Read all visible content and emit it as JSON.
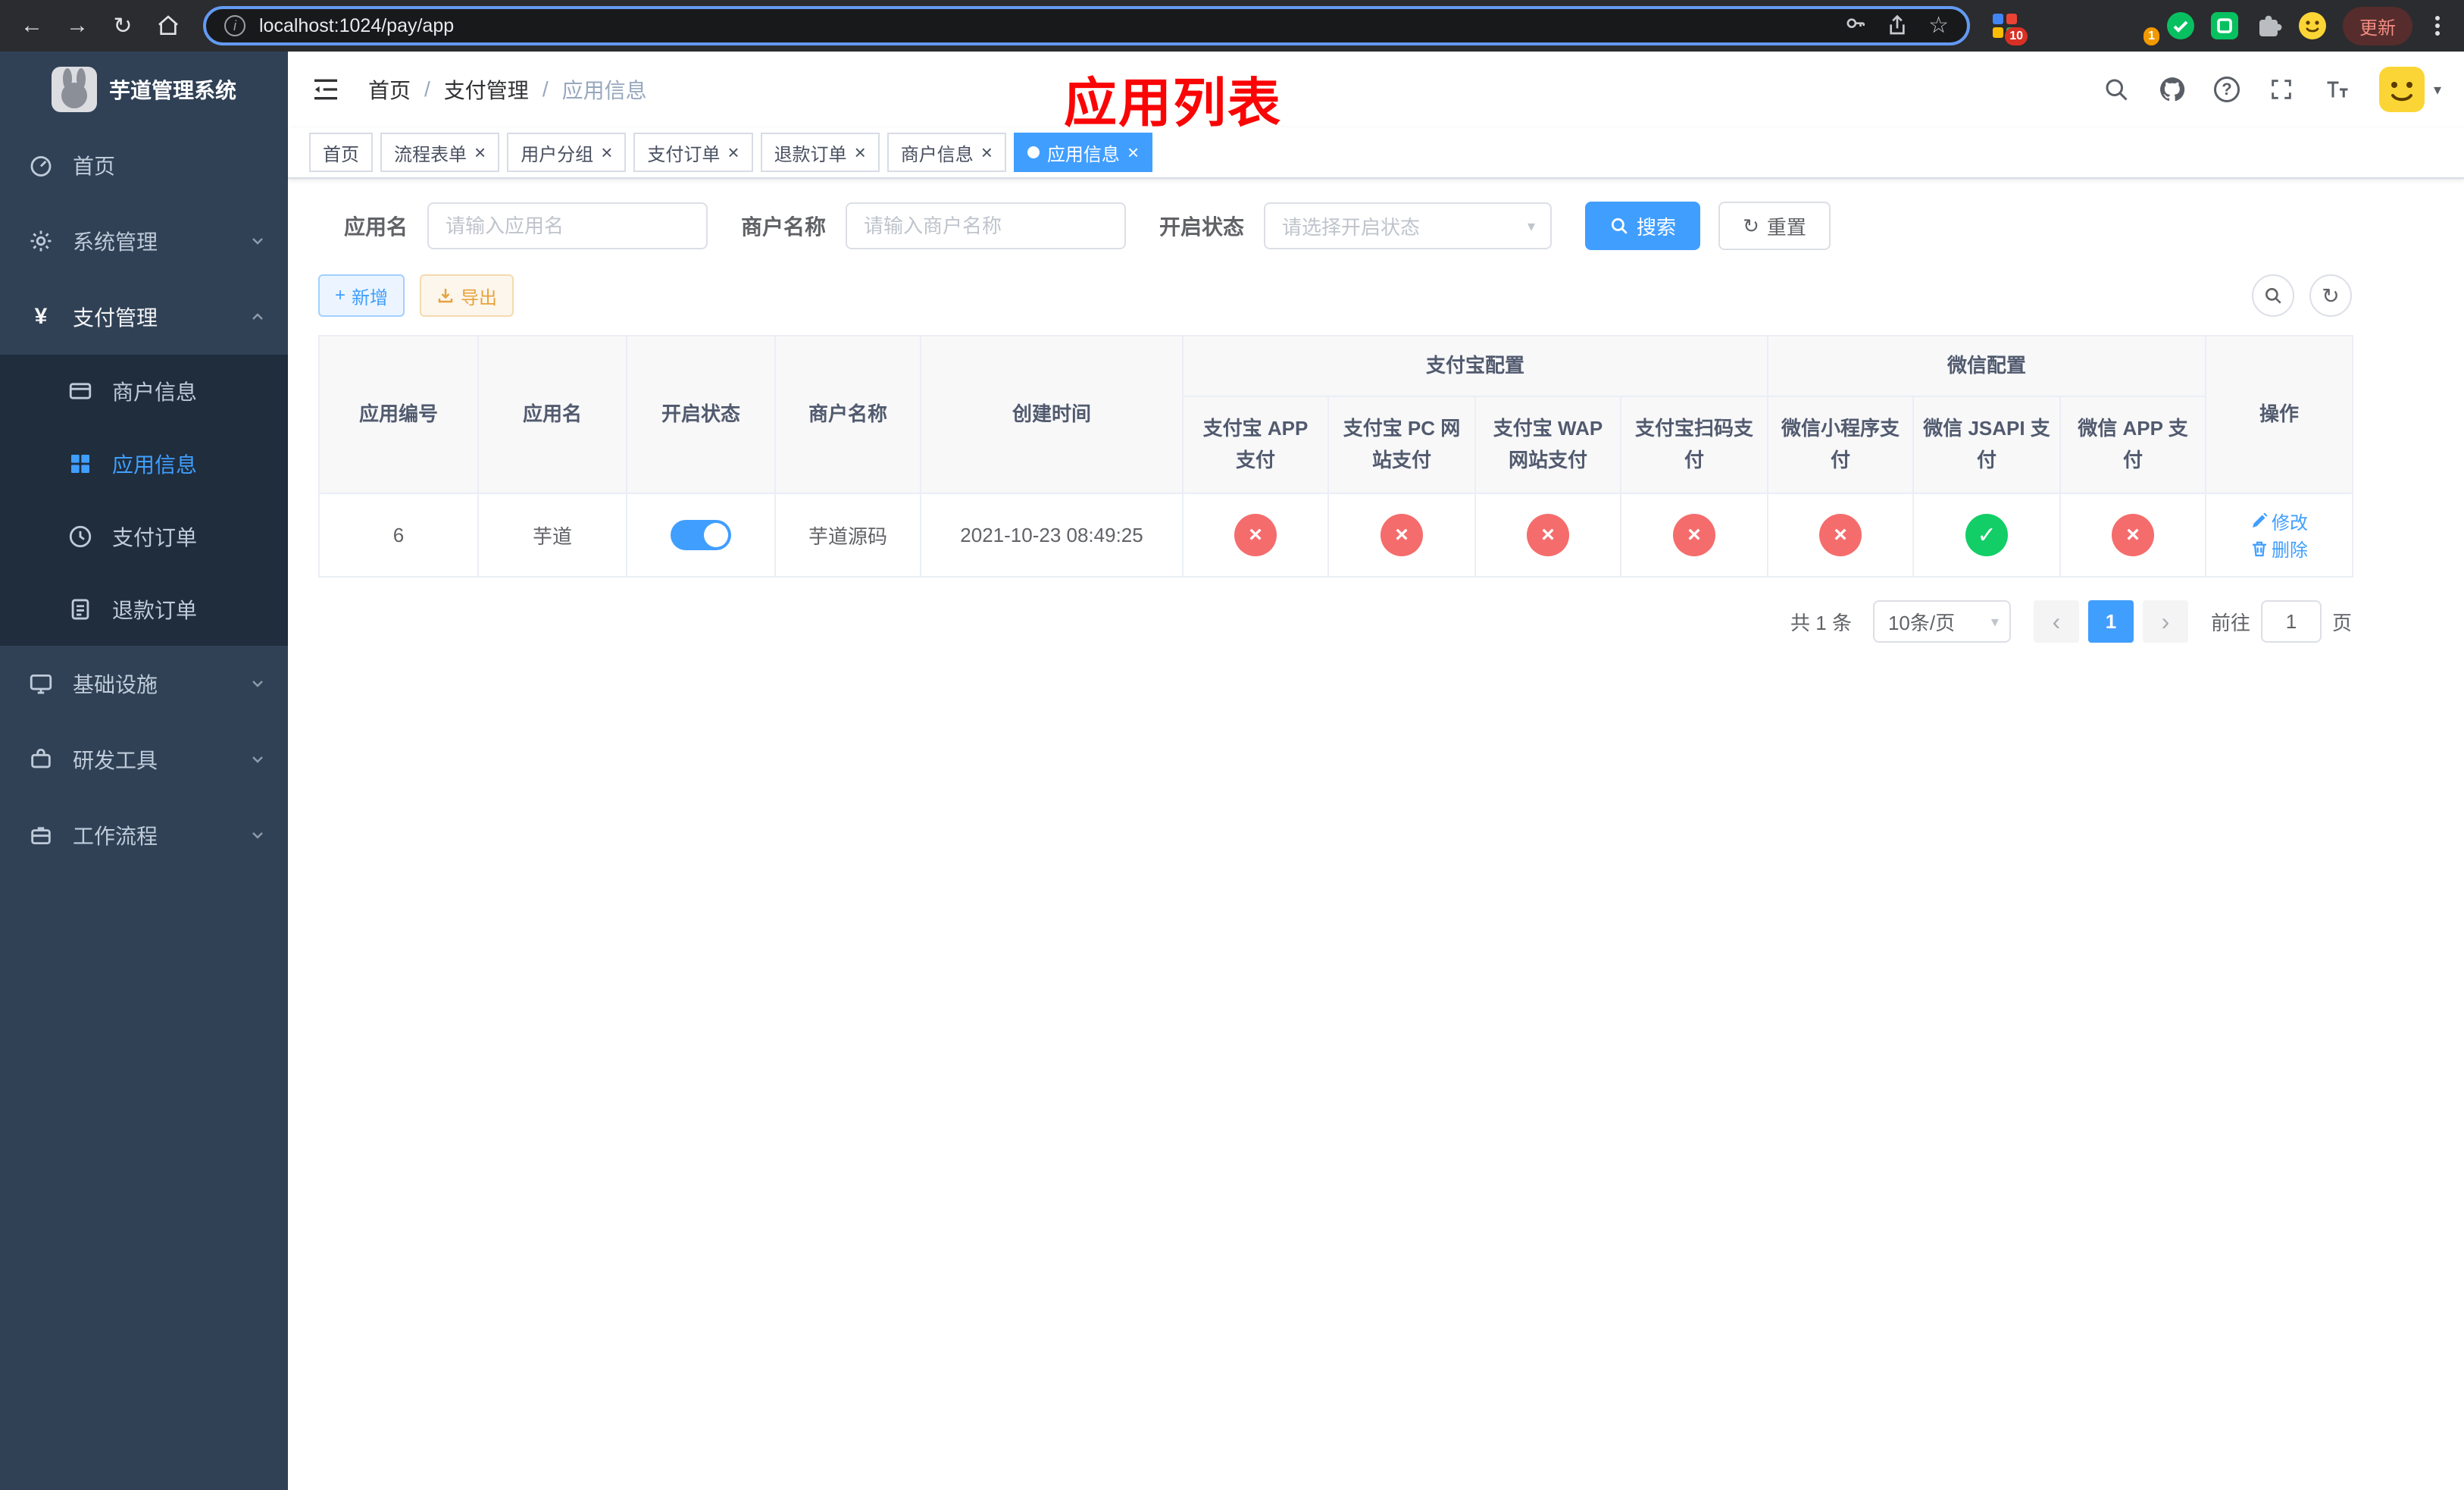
{
  "browser": {
    "url": "localhost:1024/pay/app",
    "update_label": "更新",
    "badges": {
      "extensions": "10",
      "profile": "1"
    }
  },
  "icons": {
    "back": "←",
    "forward": "→",
    "reload": "↻",
    "info": "i",
    "star": "☆",
    "question": "?",
    "breadcrumb_separator": "/",
    "tab_close": "×",
    "plus": "+",
    "check": "✓",
    "cross": "×",
    "prev": "‹",
    "next": "›",
    "yen": "¥",
    "caret_down": "▾"
  },
  "sidebar": {
    "title": "芋道管理系统",
    "items": {
      "home": "首页",
      "system": "系统管理",
      "payment": "支付管理",
      "infra": "基础设施",
      "devtools": "研发工具",
      "workflow": "工作流程"
    },
    "payment_children": {
      "merchant": "商户信息",
      "app": "应用信息",
      "order": "支付订单",
      "refund": "退款订单"
    }
  },
  "navbar": {
    "breadcrumb": [
      "首页",
      "支付管理",
      "应用信息"
    ]
  },
  "overlay_title": "应用列表",
  "tabs": [
    {
      "label": "首页"
    },
    {
      "label": "流程表单"
    },
    {
      "label": "用户分组"
    },
    {
      "label": "支付订单"
    },
    {
      "label": "退款订单"
    },
    {
      "label": "商户信息"
    },
    {
      "label": "应用信息"
    }
  ],
  "filters": {
    "app_name": {
      "label": "应用名",
      "placeholder": "请输入应用名",
      "value": ""
    },
    "merchant_name": {
      "label": "商户名称",
      "placeholder": "请输入商户名称",
      "value": ""
    },
    "status": {
      "label": "开启状态",
      "placeholder": "请选择开启状态"
    },
    "search_label": "搜索",
    "reset_label": "重置"
  },
  "toolbar": {
    "add_label": "新增",
    "export_label": "导出"
  },
  "table": {
    "columns": {
      "id": "应用编号",
      "name": "应用名",
      "status": "开启状态",
      "merchant": "商户名称",
      "created": "创建时间",
      "actions": "操作"
    },
    "groups": {
      "alipay": "支付宝配置",
      "wechat": "微信配置"
    },
    "alipay_columns": [
      "支付宝 APP 支付",
      "支付宝 PC 网站支付",
      "支付宝 WAP 网站支付",
      "支付宝扫码支付"
    ],
    "wechat_columns": [
      "微信小程序支付",
      "微信 JSAPI 支付",
      "微信 APP 支付"
    ],
    "rows": [
      {
        "id": "6",
        "name": "芋道",
        "enabled": true,
        "merchant": "芋道源码",
        "created_at": "2021-10-23 08:49:25",
        "alipay_status": {
          "app": false,
          "pc": false,
          "wap": false,
          "qr": false
        },
        "wechat_status": {
          "mini": false,
          "jsapi": true,
          "app": false
        },
        "edit_label": "修改",
        "delete_label": "删除"
      }
    ]
  },
  "pagination": {
    "total": "共 1 条",
    "page_size": "10条/页",
    "page": "1",
    "goto_label": "前往",
    "goto_value": "1",
    "goto_suffix": "页"
  }
}
